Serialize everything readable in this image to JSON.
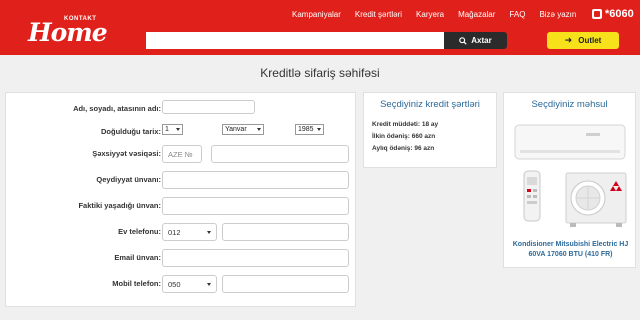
{
  "header": {
    "logo_text": "Home",
    "logo_subtext": "KONTAKT",
    "nav": [
      "Kampaniyalar",
      "Kredit şərtləri",
      "Karyera",
      "Mağazalar",
      "FAQ",
      "Bizə yazın"
    ],
    "phone": "*6060",
    "search": {
      "placeholder": "",
      "button_label": "Axtar"
    },
    "outlet_label": "Outlet",
    "accent_color": "#e0211b"
  },
  "page_title": "Kreditlə sifariş səhifəsi",
  "form": {
    "fields": {
      "name_label": "Adı, soyadı, atasının adı:",
      "dob_label": "Doğulduğu tarix:",
      "dob_day": "1",
      "dob_month": "Yanvar",
      "dob_year": "1985",
      "id_label": "Şəxsiyyət vəsiqəsi:",
      "id_prefix": "AZE №",
      "address_label": "Qeydiyyat ünvanı:",
      "actual_address_label": "Faktiki yaşadığı ünvan:",
      "home_phone_label": "Ev telefonu:",
      "home_phone_code": "012",
      "email_label": "Email ünvan:",
      "mobile_label": "Mobil telefon:",
      "mobile_code": "050"
    }
  },
  "credit": {
    "title": "Seçdiyiniz kredit şərtləri",
    "term": "Kredit müddəti: 18 ay",
    "down_payment": "İlkin ödəniş: 660 azn",
    "monthly": "Aylıq ödəniş: 96 azn"
  },
  "product": {
    "title": "Seçdiyiniz məhsul",
    "name": "Kondisioner Mitsubishi Electric HJ 60VA 17060 BTU (410 FR)",
    "image_icon": "air-conditioner-icon"
  }
}
